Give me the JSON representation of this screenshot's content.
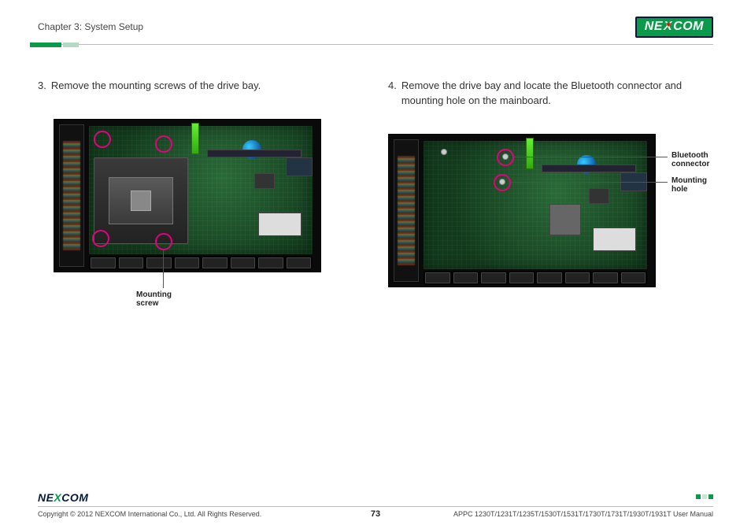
{
  "header": {
    "chapter": "Chapter 3: System Setup",
    "logo_text_left": "NE",
    "logo_text_x": "X",
    "logo_text_right": "COM"
  },
  "steps": {
    "s3": {
      "num": "3.",
      "text": "Remove the mounting screws of the drive bay."
    },
    "s4": {
      "num": "4.",
      "text": "Remove the drive bay and locate the Bluetooth connector and mounting hole on the mainboard."
    }
  },
  "labels": {
    "mounting_screw_l1": "Mounting",
    "mounting_screw_l2": "screw",
    "bt_conn_l1": "Bluetooth",
    "bt_conn_l2": "connector",
    "mhole_l1": "Mounting",
    "mhole_l2": "hole"
  },
  "footer": {
    "copyright": "Copyright © 2012 NEXCOM International Co., Ltd. All Rights Reserved.",
    "page": "73",
    "manual": "APPC 1230T/1231T/1235T/1530T/1531T/1730T/1731T/1930T/1931T User Manual",
    "logo_ne": "NE",
    "logo_x": "X",
    "logo_com": "COM"
  }
}
